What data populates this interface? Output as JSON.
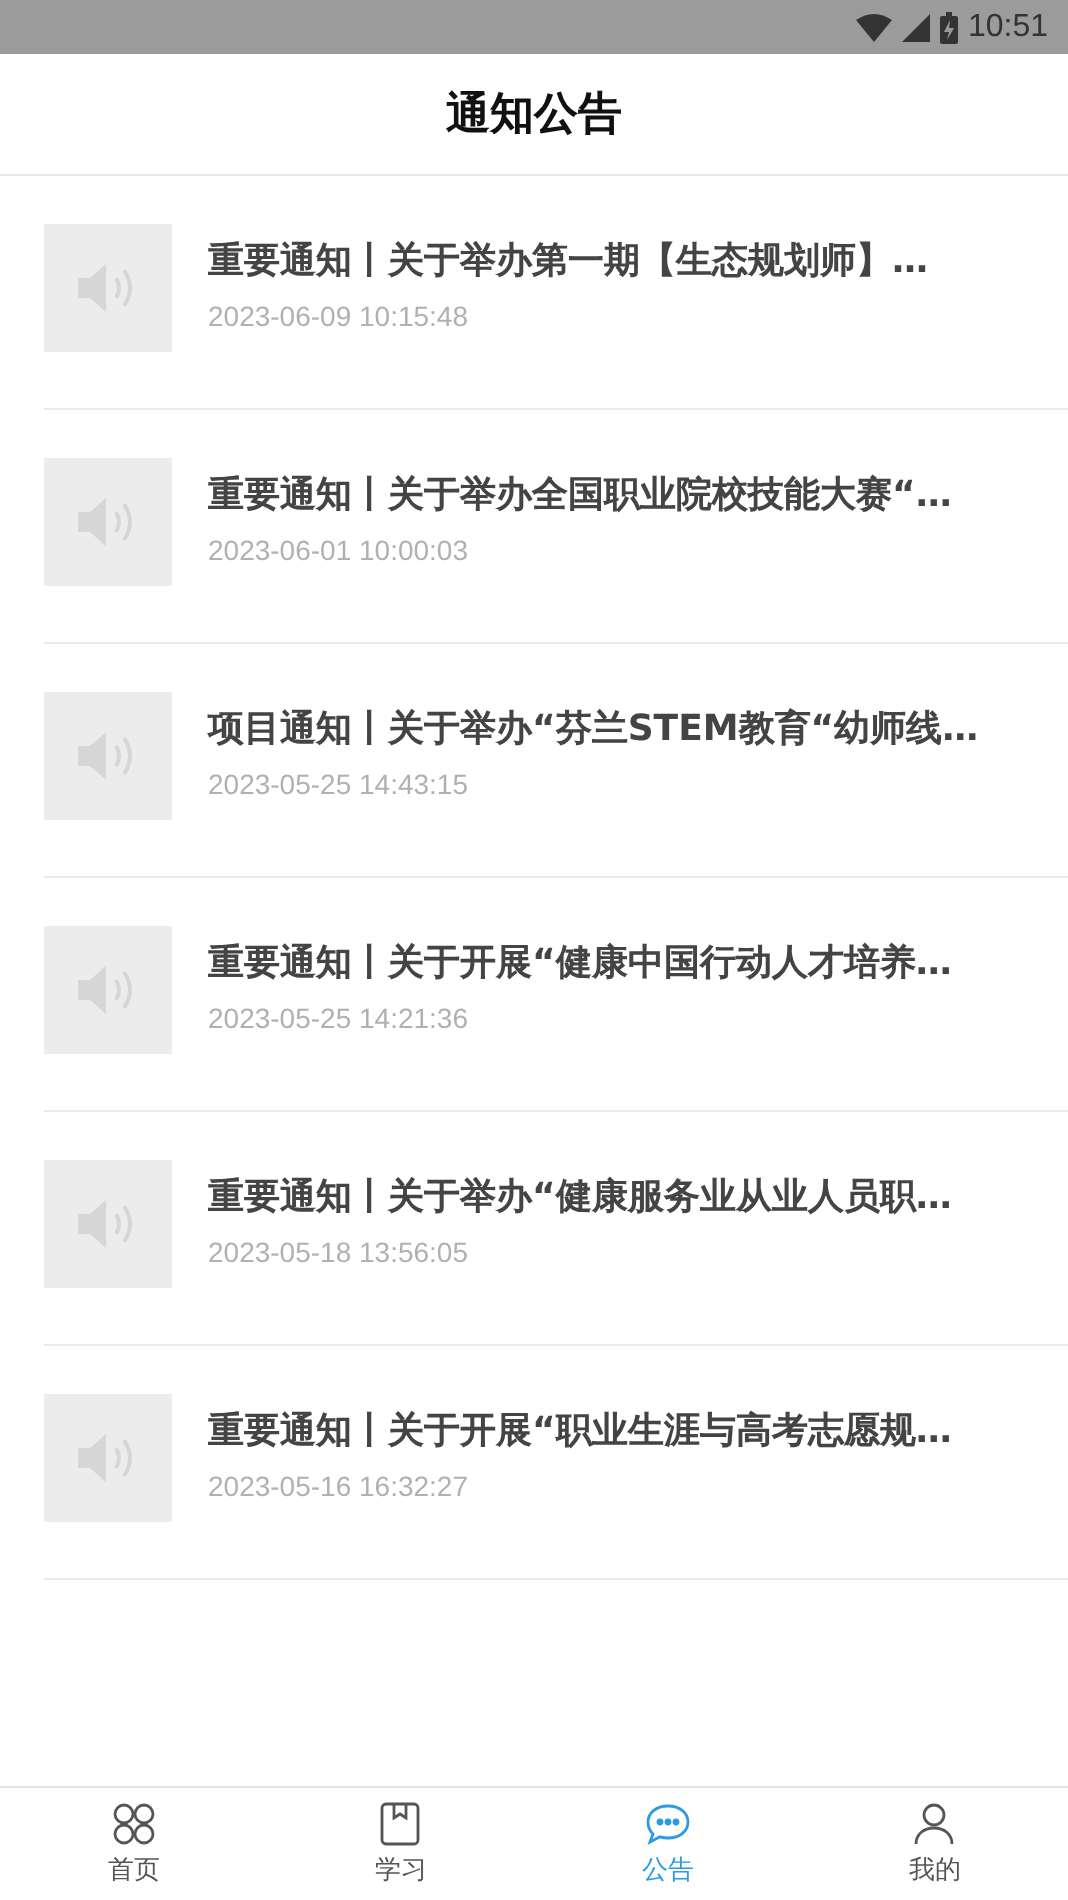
{
  "status_bar": {
    "time": "10:51"
  },
  "header": {
    "title": "通知公告"
  },
  "notices": [
    {
      "title": "重要通知丨关于举办第一期【生态规划师】…",
      "time": "2023-06-09 10:15:48"
    },
    {
      "title": "重要通知丨关于举办全国职业院校技能大赛“…",
      "time": "2023-06-01 10:00:03"
    },
    {
      "title": "项目通知丨关于举办“芬兰STEM教育“幼师线…",
      "time": "2023-05-25 14:43:15"
    },
    {
      "title": "重要通知丨关于开展“健康中国行动人才培养…",
      "time": "2023-05-25 14:21:36"
    },
    {
      "title": "重要通知丨关于举办“健康服务业从业人员职…",
      "time": "2023-05-18 13:56:05"
    },
    {
      "title": "重要通知丨关于开展“职业生涯与高考志愿规…",
      "time": "2023-05-16 16:32:27"
    }
  ],
  "tab_bar": [
    {
      "kind": "home",
      "label": "首页",
      "selected": false
    },
    {
      "kind": "study",
      "label": "学习",
      "selected": false
    },
    {
      "kind": "notice",
      "label": "公告",
      "selected": true
    },
    {
      "kind": "mine",
      "label": "我的",
      "selected": false
    }
  ]
}
